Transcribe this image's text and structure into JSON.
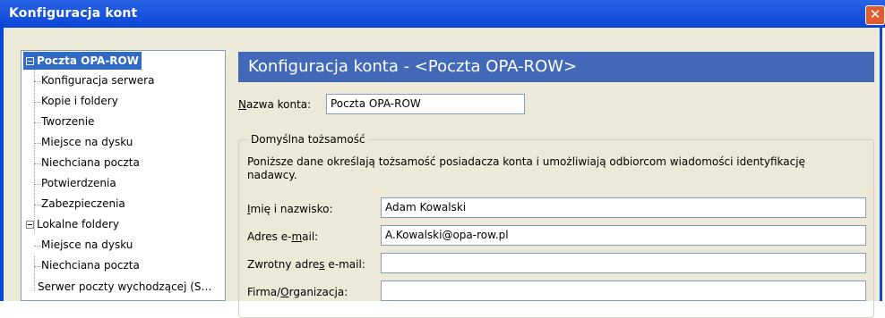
{
  "window": {
    "title": "Konfiguracja kont",
    "close_glyph": "✕"
  },
  "tree": {
    "root1": "Poczta OPA-ROW",
    "root1_children": [
      "Konfiguracja serwera",
      "Kopie i foldery",
      "Tworzenie",
      "Miejsce na dysku",
      "Niechciana poczta",
      "Potwierdzenia",
      "Zabezpieczenia"
    ],
    "root2": "Lokalne foldery",
    "root2_children": [
      "Miejsce na dysku",
      "Niechciana poczta"
    ],
    "root3": "Serwer poczty wychodzącej (S…"
  },
  "panel": {
    "header": "Konfiguracja konta - <Poczta OPA-ROW>",
    "account_name_label_u": "N",
    "account_name_label_rest": "azwa konta:",
    "account_name_value": "Poczta OPA-ROW",
    "identity": {
      "legend": "Domyślna tożsamość",
      "description": "Poniższe dane określają tożsamość posiadacza konta i umożliwiają odbiorcom wiadomości identyfikację nadawcy.",
      "fields": [
        {
          "label_before": "",
          "label_u": "I",
          "label_after": "mię i nazwisko:",
          "value": "Adam Kowalski"
        },
        {
          "label_before": "Adres e-",
          "label_u": "m",
          "label_after": "ail:",
          "value": "A.Kowalski@opa-row.pl"
        },
        {
          "label_before": "Zwrotny adre",
          "label_u": "s",
          "label_after": " e-mail:",
          "value": ""
        },
        {
          "label_before": "Firma/",
          "label_u": "O",
          "label_after": "rganizacja:",
          "value": ""
        }
      ]
    }
  }
}
